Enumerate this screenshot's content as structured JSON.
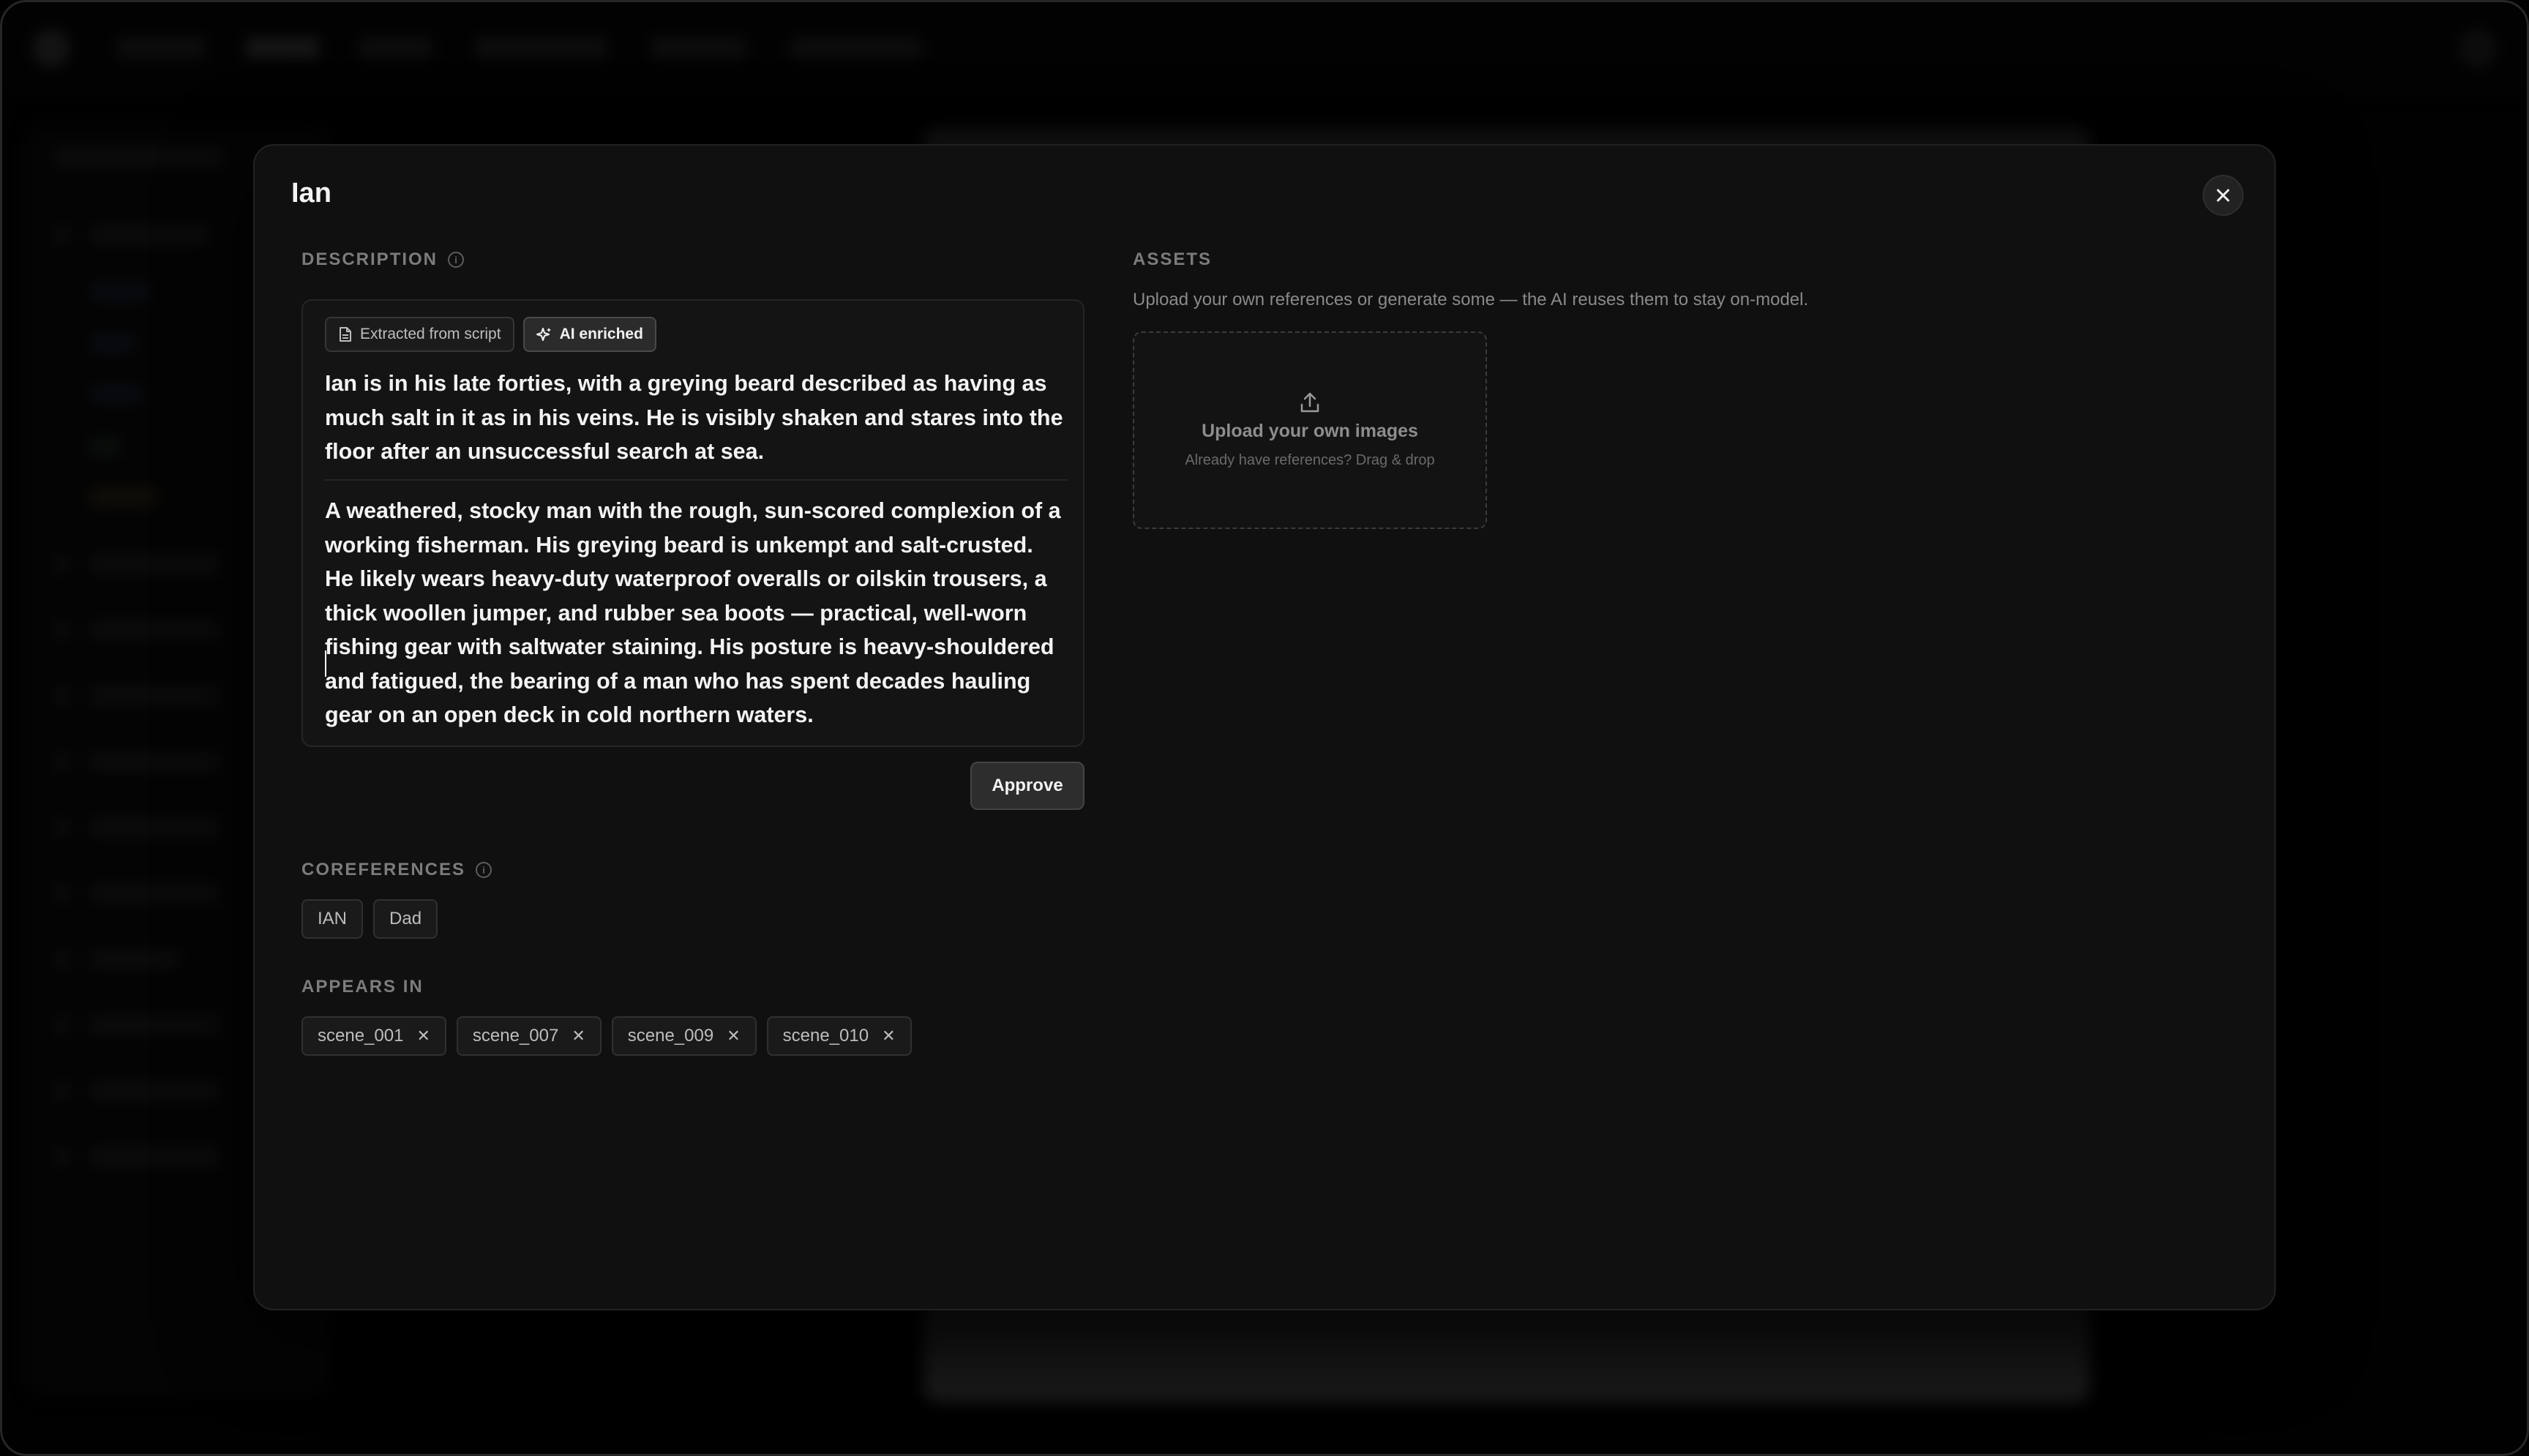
{
  "modal": {
    "title": "Ian",
    "close_label": "close"
  },
  "description": {
    "label": "DESCRIPTION",
    "chips": [
      {
        "label": "Extracted from script",
        "icon": "document-icon"
      },
      {
        "label": "AI enriched",
        "icon": "sparkles-icon"
      }
    ],
    "extracted_text": "Ian is in his late forties, with a greying beard described as having as much salt in it as in his veins. He is visibly shaken and stares into the floor after an unsuccessful search at sea.",
    "enriched_text": "A weathered, stocky man with the rough, sun-scored complexion of a working fisherman. His greying beard is unkempt and salt-crusted. He likely wears heavy-duty waterproof overalls or oilskin trousers, a thick woollen jumper, and rubber sea boots — practical, well-worn fishing gear with saltwater staining. His posture is heavy-shouldered and fatigued, the bearing of a man who has spent decades hauling gear on an open deck in cold northern waters.",
    "approve_label": "Approve"
  },
  "coreferences": {
    "label": "COREFERENCES",
    "items": [
      "IAN",
      "Dad"
    ]
  },
  "appears_in": {
    "label": "APPEARS IN",
    "items": [
      "scene_001",
      "scene_007",
      "scene_009",
      "scene_010"
    ]
  },
  "assets": {
    "label": "ASSETS",
    "hint": "Upload your own references or generate some — the AI reuses them to stay on-model.",
    "upload_title": "Upload your own images",
    "upload_sub": "Already have references? Drag & drop",
    "upload_icon": "upload-icon"
  }
}
